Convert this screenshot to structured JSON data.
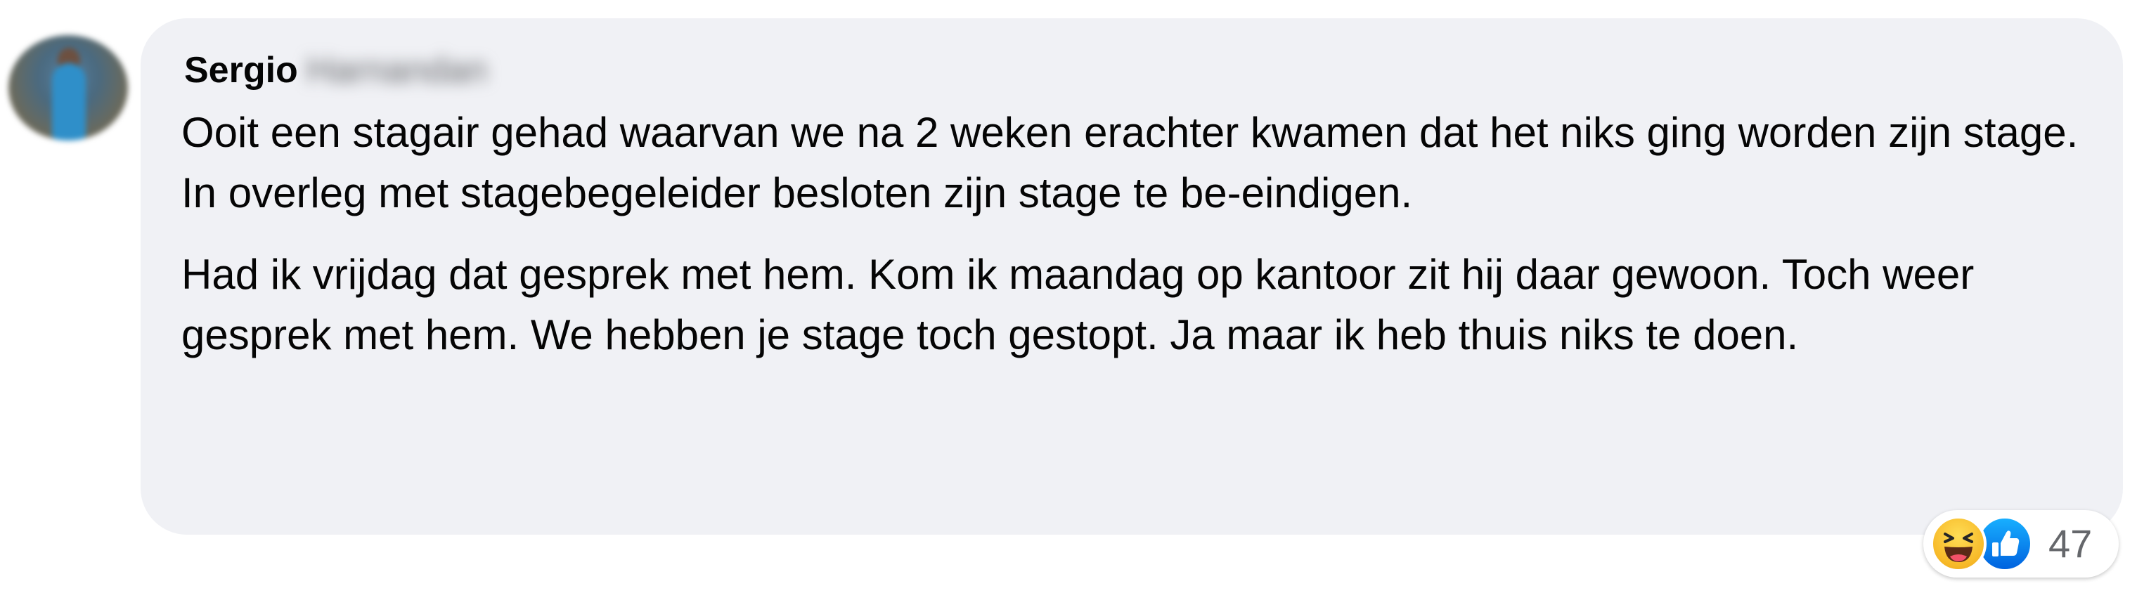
{
  "comment": {
    "author_first_name": "Sergio",
    "author_last_name_blurred": "Harnandan",
    "paragraphs": [
      "Ooit een stagair gehad waarvan we na 2 weken erachter kwamen dat het niks ging worden zijn stage. In overleg met stagebegeleider besloten zijn stage te be-eindigen.",
      "Had ik vrijdag dat gesprek met hem. Kom ik maandag op kantoor zit hij daar gewoon. Toch weer gesprek met hem. We hebben je stage toch gestopt. Ja maar ik heb thuis niks te doen."
    ]
  },
  "reactions": {
    "icons": [
      "haha-icon",
      "like-icon"
    ],
    "count": "47"
  },
  "colors": {
    "bubble_background": "#f0f1f5",
    "text": "#050505",
    "secondary_text": "#65676b",
    "like_blue": "#0866ff",
    "haha_yellow": "#f7b928"
  }
}
